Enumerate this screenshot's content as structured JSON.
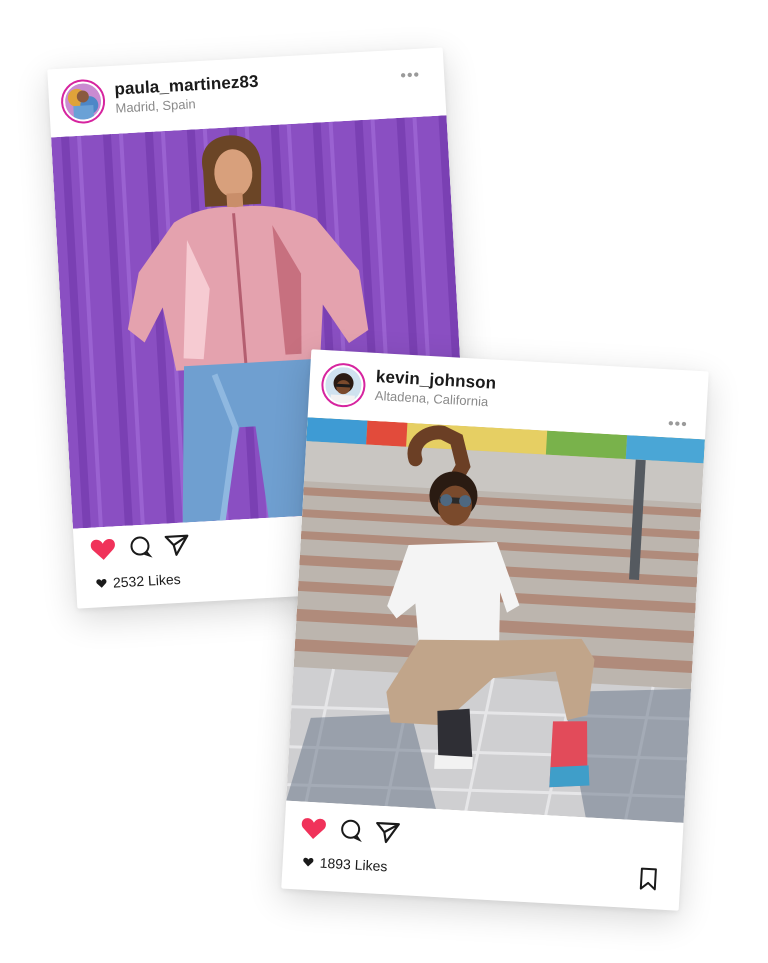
{
  "posts": [
    {
      "username": "paula_martinez83",
      "location": "Madrid, Spain",
      "more_label": "•••",
      "likes_text": "2532 Likes",
      "liked": true,
      "photo_bg": "#8a4fc2"
    },
    {
      "username": "kevin_johnson",
      "location": "Altadena, California",
      "more_label": "•••",
      "likes_text": "1893 Likes",
      "liked": true,
      "photo_bg": "#b9b4ad"
    }
  ],
  "colors": {
    "like": "#f0325a",
    "avatar_ring": "#d6249f",
    "text": "#1a1a1a",
    "muted": "#8a8a8a"
  },
  "icons": [
    "heart-icon",
    "comment-icon",
    "share-icon",
    "bookmark-icon",
    "more-icon",
    "small-heart-icon"
  ]
}
